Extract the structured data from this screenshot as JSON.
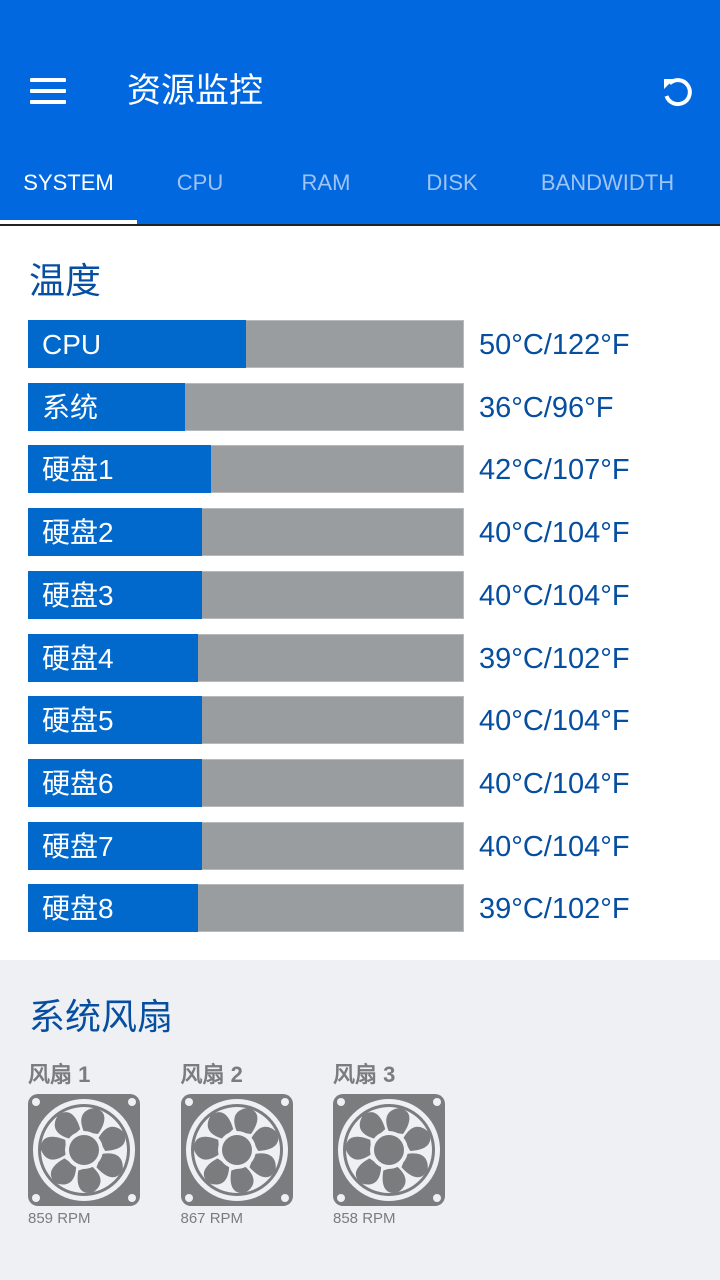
{
  "header": {
    "title": "资源监控",
    "menu_icon": "hamburger-menu-icon",
    "refresh_icon": "refresh-icon"
  },
  "tabs": [
    {
      "label": "SYSTEM",
      "active": true
    },
    {
      "label": "CPU",
      "active": false
    },
    {
      "label": "RAM",
      "active": false
    },
    {
      "label": "DISK",
      "active": false
    },
    {
      "label": "BANDWIDTH",
      "active": false
    }
  ],
  "temperature": {
    "title": "温度",
    "items": [
      {
        "label": "CPU",
        "celsius": 50,
        "value": "50°C/122°F",
        "fill_percent": 50
      },
      {
        "label": "系统",
        "celsius": 36,
        "value": "36°C/96°F",
        "fill_percent": 36
      },
      {
        "label": "硬盘1",
        "celsius": 42,
        "value": "42°C/107°F",
        "fill_percent": 42
      },
      {
        "label": "硬盘2",
        "celsius": 40,
        "value": "40°C/104°F",
        "fill_percent": 40
      },
      {
        "label": "硬盘3",
        "celsius": 40,
        "value": "40°C/104°F",
        "fill_percent": 40
      },
      {
        "label": "硬盘4",
        "celsius": 39,
        "value": "39°C/102°F",
        "fill_percent": 39
      },
      {
        "label": "硬盘5",
        "celsius": 40,
        "value": "40°C/104°F",
        "fill_percent": 40
      },
      {
        "label": "硬盘6",
        "celsius": 40,
        "value": "40°C/104°F",
        "fill_percent": 40
      },
      {
        "label": "硬盘7",
        "celsius": 40,
        "value": "40°C/104°F",
        "fill_percent": 40
      },
      {
        "label": "硬盘8",
        "celsius": 39,
        "value": "39°C/102°F",
        "fill_percent": 39
      }
    ]
  },
  "fans": {
    "title": "系统风扇",
    "items": [
      {
        "name": "风扇 1",
        "rpm": "859 RPM",
        "icon": "fan-icon"
      },
      {
        "name": "风扇 2",
        "rpm": "867 RPM",
        "icon": "fan-icon"
      },
      {
        "name": "风扇 3",
        "rpm": "858 RPM",
        "icon": "fan-icon"
      }
    ]
  },
  "colors": {
    "primary": "#0168e0",
    "bar_fill": "#0168cc",
    "bar_track": "#9a9da0",
    "heading_text": "#064ea0",
    "fan_gray": "#7a7c7e",
    "fan_section_bg": "#eef0f4"
  }
}
